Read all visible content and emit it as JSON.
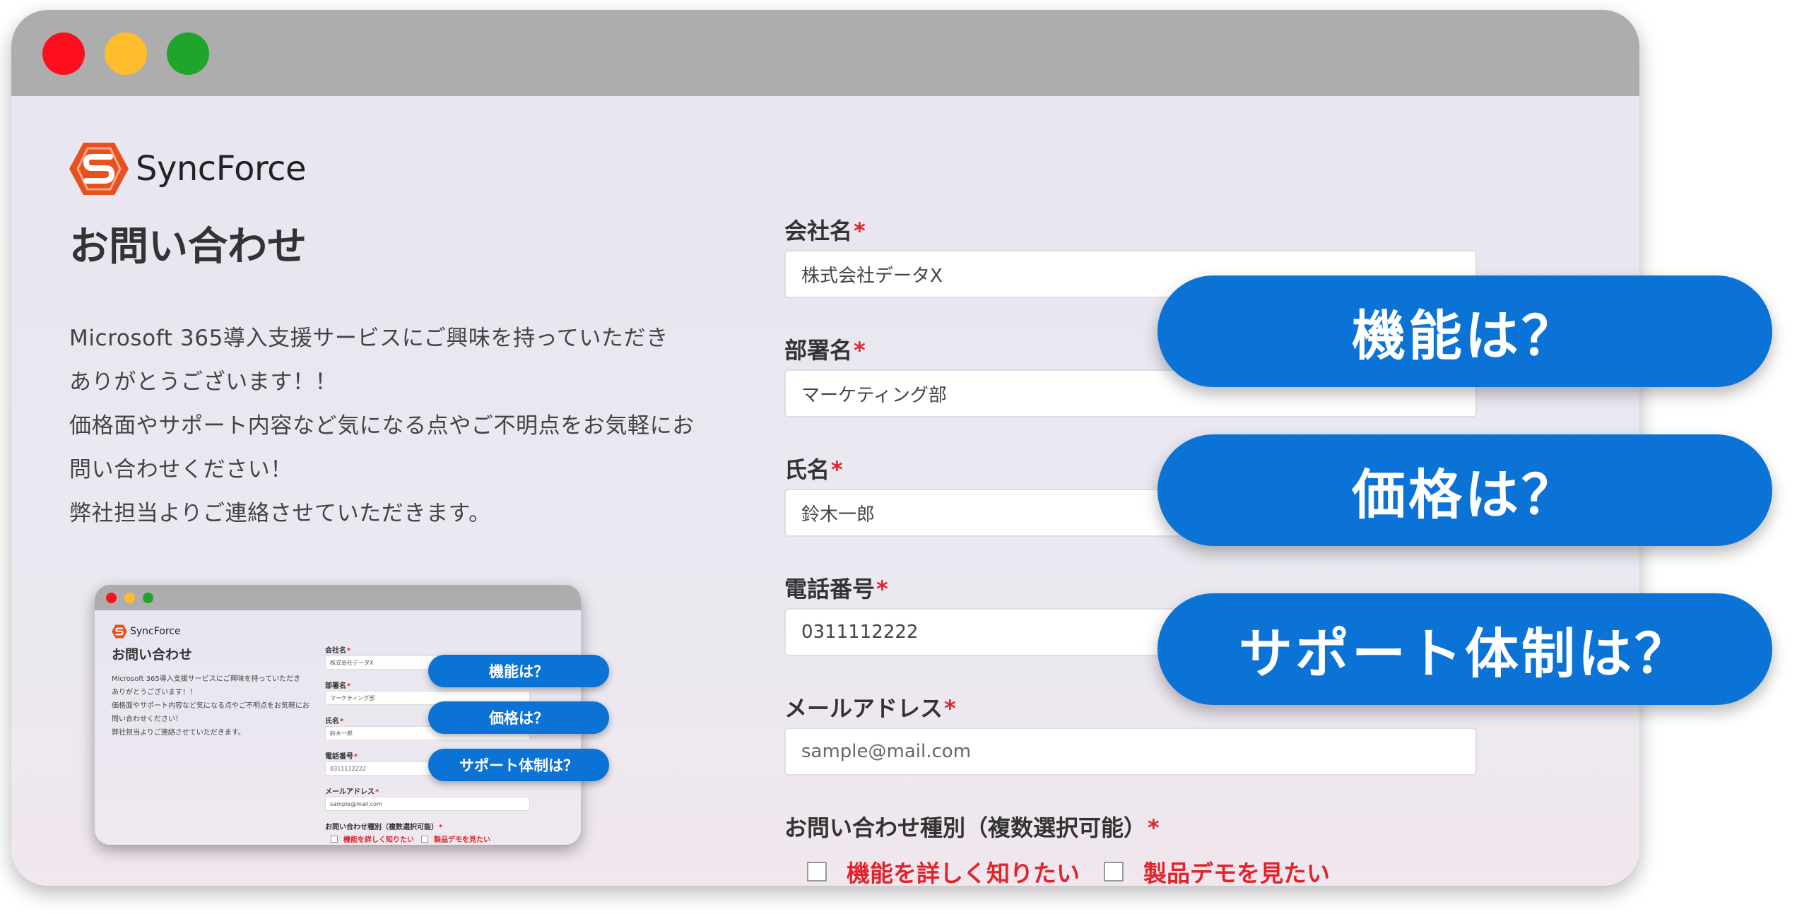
{
  "brand": {
    "name": "SyncForce",
    "accent": "#0b72d6",
    "logo_color": "#e8501e"
  },
  "page": {
    "title": "お問い合わせ",
    "intro": [
      "Microsoft 365導入支援サービスにご興味を持っていただき",
      "ありがとうございます！！",
      "価格面やサポート内容など気になる点やご不明点をお気軽にお",
      "問い合わせください！",
      "弊社担当よりご連絡させていただきます。"
    ]
  },
  "form": {
    "required_mark": "*",
    "company": {
      "label": "会社名",
      "value": "株式会社データX"
    },
    "department": {
      "label": "部署名",
      "value": "マーケティング部"
    },
    "name": {
      "label": "氏名",
      "value": "鈴木一郎"
    },
    "phone": {
      "label": "電話番号",
      "value": "0311112222"
    },
    "email": {
      "label": "メールアドレス",
      "placeholder": "sample@mail.com"
    },
    "inquiry_type": {
      "label": "お問い合わせ種別（複数選択可能）",
      "options": [
        "機能を詳しく知りたい",
        "製品デモを見たい"
      ]
    }
  },
  "callouts": [
    "機能は？",
    "価格は？",
    "サポート体制は？"
  ]
}
